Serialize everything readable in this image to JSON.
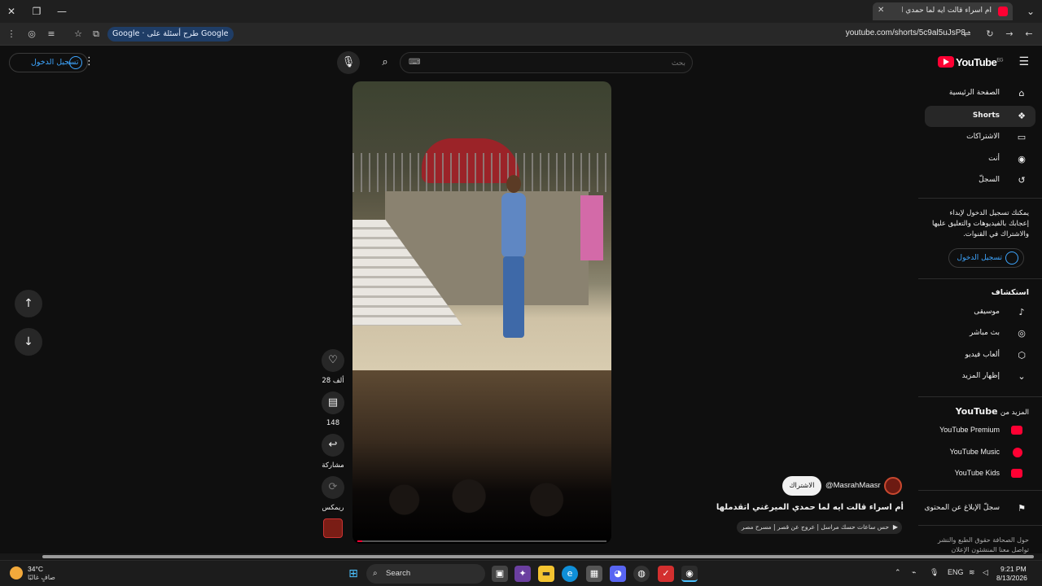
{
  "browser": {
    "tab_title": "أم اسراء قالت ايه لما حمدي ال...",
    "url": "youtube.com/shorts/5c9al5uJsP8",
    "google_pill": "طرح أسئلة على Google",
    "icons": [
      "close-icon",
      "restore-icon",
      "minimize-icon",
      "new-tab-icon",
      "reload-icon",
      "back-icon",
      "forward-icon",
      "star-icon"
    ]
  },
  "header": {
    "sign_in": "تسجيل الدخول",
    "search_placeholder": "بحث",
    "logo_text": "YouTube",
    "logo_region": "EG"
  },
  "sidebar": {
    "nav": [
      {
        "label": "الصفحة الرئيسية",
        "icon": "home-icon"
      },
      {
        "label": "Shorts",
        "icon": "shorts-icon"
      },
      {
        "label": "الاشتراكات",
        "icon": "subscriptions-icon"
      },
      {
        "label": "أنت",
        "icon": "you-icon"
      },
      {
        "label": "السجلّ",
        "icon": "history-icon"
      }
    ],
    "note": "يمكنك تسجيل الدخول لإبداء إعجابك بالفيديوهات والتعليق عليها والاشتراك في القنوات.",
    "sign_in": "تسجيل الدخول",
    "explore_title": "استكشاف",
    "explore": [
      {
        "label": "موسيقى",
        "icon": "music-icon"
      },
      {
        "label": "بث مباشر",
        "icon": "live-icon"
      },
      {
        "label": "ألعاب فيديو",
        "icon": "gaming-icon"
      },
      {
        "label": "إظهار المزيد",
        "icon": "chevron-down-icon"
      }
    ],
    "more_from_prefix": "المزيد من",
    "more_from_brand": "YouTube",
    "more_items": [
      "YouTube Premium",
      "YouTube Music",
      "YouTube Kids"
    ],
    "report_history": "سجلّ الإبلاغ عن المحتوى",
    "footer": "حول  الصحافة  حقوق الطبع والنشر  تواصل معنا  المنشئون  الإعلان"
  },
  "short": {
    "likes": "28 ألف",
    "comments": "148",
    "share": "مشاركة",
    "remix": "ريمكس",
    "channel": "@MasrahMaasr",
    "subscribe": "الاشتراك",
    "title": "أم اسراء قالت ايه لما حمدي الميرغني اتقدملها",
    "music": "حس ساعات حسك مراسل | عروج عن قصر | مسرح مصر",
    "progress": 0.02
  },
  "taskbar": {
    "temp": "34°C",
    "weather": "صافٍ غالبًا",
    "search": "Search",
    "lang": "ENG",
    "time": "9:21 PM",
    "date": "8/13/2026"
  }
}
